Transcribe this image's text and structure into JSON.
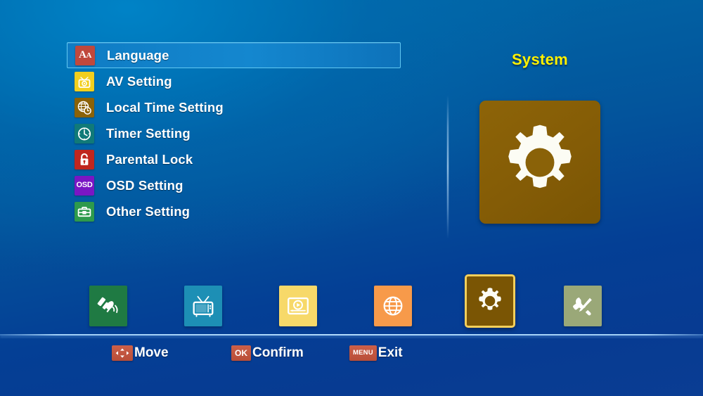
{
  "screen": {
    "title": "System",
    "background_top": "#0069a8",
    "background_bottom": "#0a3d93",
    "accent_yellow": "#fff100",
    "highlight_blue": "#1487cf",
    "highlight_border": "#62c8f2"
  },
  "menu": {
    "selected_index": 0,
    "items": [
      {
        "label": "Language",
        "icon": "aa-letters-icon",
        "icon_bg": "#c0483c",
        "selected": true
      },
      {
        "label": "AV Setting",
        "icon": "tv-camera-icon",
        "icon_bg": "#f2cf1e",
        "selected": false
      },
      {
        "label": "Local Time Setting",
        "icon": "globe-clock-icon",
        "icon_bg": "#8a6208",
        "selected": false
      },
      {
        "label": "Timer Setting",
        "icon": "clock-icon",
        "icon_bg": "#107a78",
        "selected": false
      },
      {
        "label": "Parental Lock",
        "icon": "padlock-icon",
        "icon_bg": "#c0261e",
        "selected": false
      },
      {
        "label": "OSD Setting",
        "icon": "osd-text-icon",
        "icon_bg": "#7a16c4",
        "selected": false
      },
      {
        "label": "Other Setting",
        "icon": "toolbox-icon",
        "icon_bg": "#2e9a4c",
        "selected": false
      }
    ]
  },
  "preview": {
    "title": "System",
    "icon": "gear-icon",
    "tile_color": "#8a6208",
    "glyph_color": "#ffffff"
  },
  "categories": {
    "selected_index": 4,
    "items": [
      {
        "name": "satellite-installation",
        "icon": "satellite-dish-icon",
        "bg": "#1f7a43",
        "selected": false
      },
      {
        "name": "channel",
        "icon": "television-icon",
        "bg": "#1d8fb5",
        "selected": false
      },
      {
        "name": "media",
        "icon": "media-player-icon",
        "bg": "#f7d969",
        "selected": false
      },
      {
        "name": "network",
        "icon": "globe-icon",
        "bg": "#f79a4a",
        "selected": false
      },
      {
        "name": "system",
        "icon": "gear-icon",
        "bg": "#7a5504",
        "selected": true
      },
      {
        "name": "tools",
        "icon": "tools-icon",
        "bg": "#9aa878",
        "selected": false
      }
    ]
  },
  "hints": [
    {
      "badge": "",
      "icon": "dpad-arrows-icon",
      "label": "Move",
      "badge_color": "#c1553f"
    },
    {
      "badge": "OK",
      "icon": "ok-key-icon",
      "label": "Confirm",
      "badge_color": "#c1553f"
    },
    {
      "badge": "MENU",
      "icon": "menu-key-icon",
      "label": "Exit",
      "badge_color": "#c1553f"
    }
  ]
}
